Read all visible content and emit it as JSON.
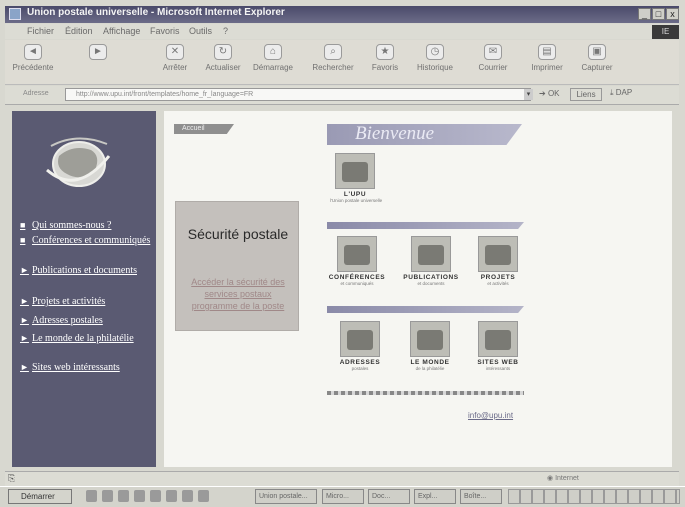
{
  "window": {
    "title": "Union postale universelle - Microsoft Internet Explorer",
    "min_label": "_",
    "max_label": "□",
    "close_label": "x"
  },
  "menu": {
    "items": [
      "Fichier",
      "Édition",
      "Affichage",
      "Favoris",
      "Outils",
      "?"
    ],
    "logo": "IE"
  },
  "toolbar": {
    "buttons": [
      {
        "label": "Précédente",
        "icon": "back-arrow-icon",
        "glyph": "◄"
      },
      {
        "label": "",
        "icon": "forward-arrow-icon",
        "glyph": "►"
      },
      {
        "label": "Arrêter",
        "icon": "stop-icon",
        "glyph": "✕"
      },
      {
        "label": "Actualiser",
        "icon": "refresh-icon",
        "glyph": "↻"
      },
      {
        "label": "Démarrage",
        "icon": "home-icon",
        "glyph": "⌂"
      },
      {
        "label": "Rechercher",
        "icon": "search-icon",
        "glyph": "⌕"
      },
      {
        "label": "Favoris",
        "icon": "favorites-icon",
        "glyph": "★"
      },
      {
        "label": "Historique",
        "icon": "history-icon",
        "glyph": "◷"
      },
      {
        "label": "Courrier",
        "icon": "mail-icon",
        "glyph": "✉"
      },
      {
        "label": "Imprimer",
        "icon": "print-icon",
        "glyph": "▤"
      },
      {
        "label": "Capturer",
        "icon": "capture-icon",
        "glyph": "▣"
      }
    ]
  },
  "address": {
    "label": "Adresse",
    "url": "http://www.upu.int/front/templates/home_fr_language=FR",
    "go_label": "OK",
    "links_label": "Liens",
    "extra_label": "DAP"
  },
  "sidebar": {
    "nav": [
      {
        "bullet": "■",
        "label": "Qui sommes-nous ?"
      },
      {
        "bullet": "■",
        "label": "Conférences et communiqués"
      },
      {
        "bullet": "►",
        "label": "Publications et documents"
      },
      {
        "bullet": "►",
        "label": "Projets et activités"
      },
      {
        "bullet": "►",
        "label": "Adresses postales"
      },
      {
        "bullet": "►",
        "label": "Le monde de la philatélie"
      },
      {
        "bullet": "►",
        "label": "Sites web intéressants"
      }
    ]
  },
  "content": {
    "accueil_label": "Accueil",
    "welcome": "Bienvenue",
    "securite": {
      "title": "Sécurité postale",
      "links": "Accéder la sécurité des services postaux programme de la poste"
    },
    "tiles_top": [
      {
        "label": "L'UPU",
        "sub": "l'Union postale universelle"
      }
    ],
    "tiles_mid": [
      {
        "label": "CONFÉRENCES",
        "sub": "et communiqués"
      },
      {
        "label": "PUBLICATIONS",
        "sub": "et documents"
      },
      {
        "label": "PROJETS",
        "sub": "et activités"
      }
    ],
    "tiles_bot": [
      {
        "label": "ADRESSES",
        "sub": "postales"
      },
      {
        "label": "LE MONDE",
        "sub": "de la philatélie"
      },
      {
        "label": "SITES WEB",
        "sub": "intéressants"
      }
    ],
    "info_link": "info@upu.int"
  },
  "status": {
    "left_icon": "page-icon",
    "zone": "Internet"
  },
  "taskbar": {
    "start_label": "Démarrer",
    "tasks": [
      "Union postale...",
      "Micro...",
      "Doc...",
      "Expl...",
      "Boîte..."
    ]
  }
}
